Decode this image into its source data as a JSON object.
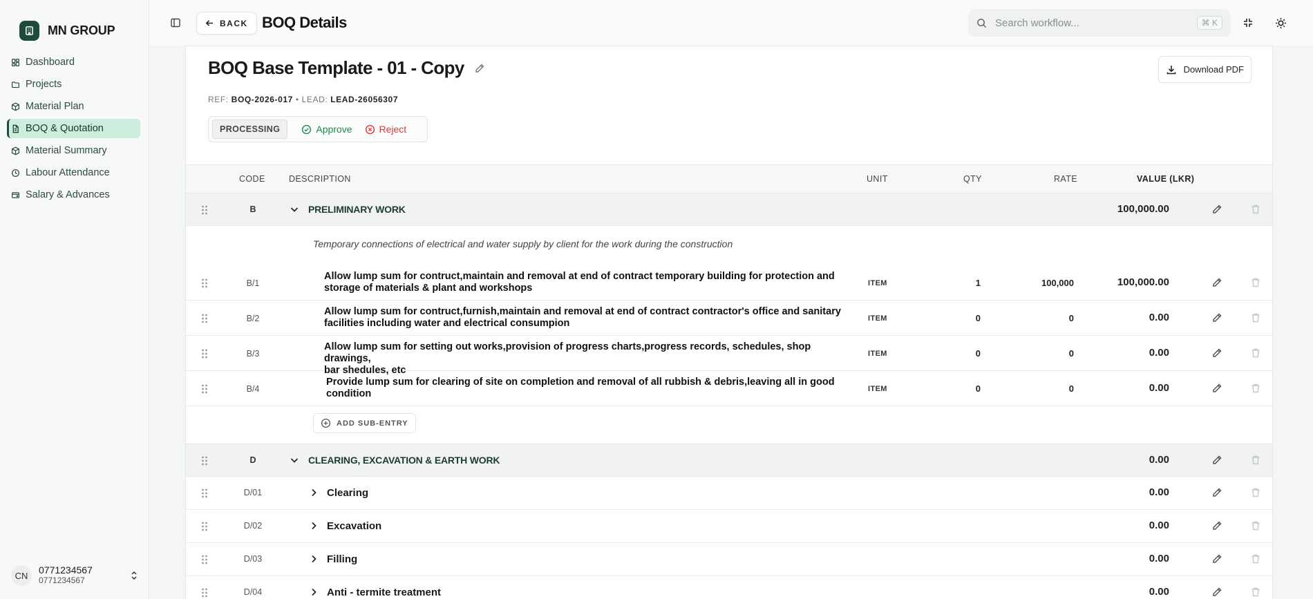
{
  "brand": {
    "name": "MN GROUP"
  },
  "sidebar": {
    "items": [
      {
        "label": "Dashboard",
        "icon": "dashboard-icon"
      },
      {
        "label": "Projects",
        "icon": "folder-icon"
      },
      {
        "label": "Material Plan",
        "icon": "box-icon"
      },
      {
        "label": "BOQ & Quotation",
        "icon": "document-icon",
        "active": true
      },
      {
        "label": "Material Summary",
        "icon": "box-icon"
      },
      {
        "label": "Labour Attendance",
        "icon": "clock-icon"
      },
      {
        "label": "Salary & Advances",
        "icon": "wallet-icon"
      }
    ]
  },
  "user": {
    "initials": "CN",
    "name": "0771234567",
    "subtitle": "0771234567"
  },
  "topbar": {
    "back_label": "BACK",
    "title": "BOQ Details",
    "search_placeholder": "Search workflow...",
    "shortcut": "⌘ K"
  },
  "doc": {
    "title": "BOQ Base Template - 01 - Copy",
    "ref_label": "REF:",
    "ref_value": "BOQ-2026-017",
    "separator": "•",
    "lead_label": "LEAD:",
    "lead_value": "LEAD-26056307",
    "status": "PROCESSING",
    "approve_label": "Approve",
    "reject_label": "Reject",
    "download_label": "Download PDF"
  },
  "table": {
    "headers": {
      "code": "CODE",
      "description": "DESCRIPTION",
      "unit": "UNIT",
      "qty": "QTY",
      "rate": "RATE",
      "value": "VALUE (LKR)"
    },
    "sections": [
      {
        "code": "B",
        "title": "PRELIMINARY WORK",
        "value": "100,000.00",
        "note": "Temporary connections of electrical and water supply by client for the work during the construction",
        "items": [
          {
            "code": "B/1",
            "desc1": "Allow lump sum for contruct,maintain and removal at end of contract temporary building for protection and",
            "desc2": "storage of materials & plant and workshops",
            "unit": "ITEM",
            "qty": "1",
            "rate": "100,000",
            "value": "100,000.00"
          },
          {
            "code": "B/2",
            "desc1": "Allow lump sum for contruct,furnish,maintain and removal at end of contract contractor's office and sanitary",
            "desc2": "facilities including water and electrical consumpion",
            "unit": "ITEM",
            "qty": "0",
            "rate": "0",
            "value": "0.00"
          },
          {
            "code": "B/3",
            "desc1": "Allow lump sum for setting out works,provision of progress charts,progress records, schedules, shop drawings,",
            "desc2": "bar shedules, etc",
            "unit": "ITEM",
            "qty": "0",
            "rate": "0",
            "value": "0.00"
          },
          {
            "code": "B/4",
            "desc1": "Provide lump sum for clearing of site on completion and removal of all rubbish & debris,leaving all in good",
            "desc2": "condition",
            "unit": "ITEM",
            "qty": "0",
            "rate": "0",
            "value": "0.00"
          }
        ],
        "add_label": "ADD SUB-ENTRY"
      },
      {
        "code": "D",
        "title": "CLEARING, EXCAVATION & EARTH WORK",
        "value": "0.00",
        "subs": [
          {
            "code": "D/01",
            "title": "Clearing",
            "value": "0.00"
          },
          {
            "code": "D/02",
            "title": "Excavation",
            "value": "0.00"
          },
          {
            "code": "D/03",
            "title": "Filling",
            "value": "0.00"
          },
          {
            "code": "D/04",
            "title": "Anti - termite treatment",
            "value": "0.00"
          }
        ]
      }
    ]
  }
}
